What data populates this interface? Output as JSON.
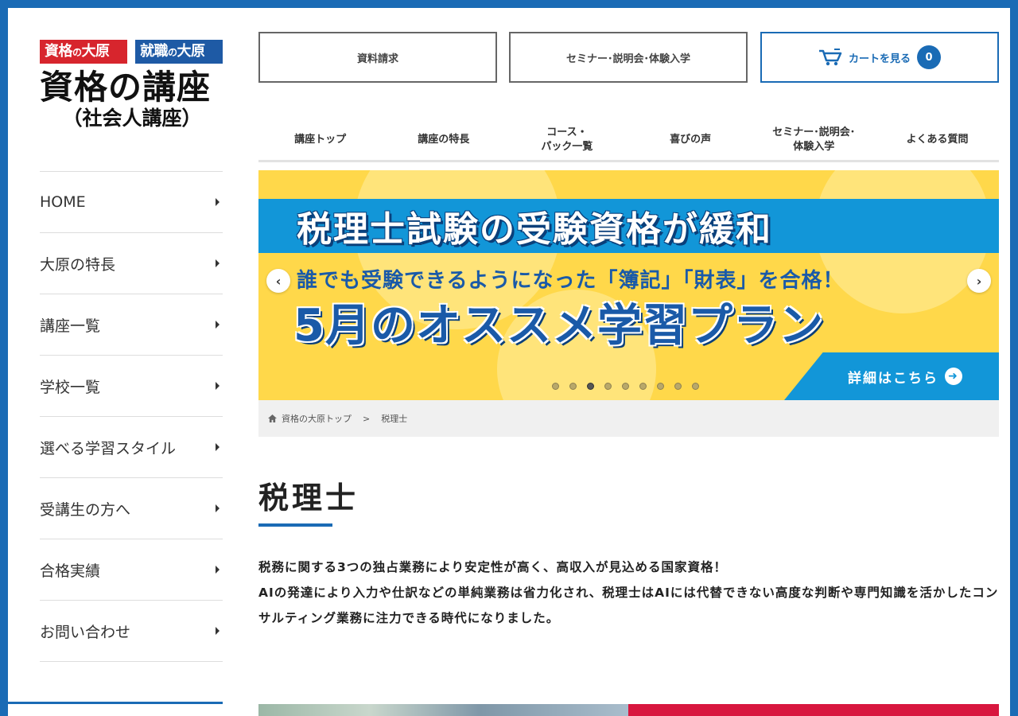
{
  "logo": {
    "tag1_a": "資格",
    "tag1_b": "の",
    "tag1_c": "大原",
    "tag2_a": "就職",
    "tag2_b": "の",
    "tag2_c": "大原",
    "title": "資格の講座",
    "subtitle": "（社会人講座）"
  },
  "sidebar": {
    "items": [
      {
        "label": "HOME"
      },
      {
        "label": "大原の特長"
      },
      {
        "label": "講座一覧"
      },
      {
        "label": "学校一覧"
      },
      {
        "label": "選べる学習スタイル"
      },
      {
        "label": "受講生の方へ"
      },
      {
        "label": "合格実績"
      },
      {
        "label": "お問い合わせ"
      }
    ]
  },
  "top_buttons": {
    "request": "資料請求",
    "seminar": "セミナー･説明会･体験入学",
    "cart": "カートを見る",
    "cart_count": "0"
  },
  "main_nav": {
    "items": [
      {
        "label": "講座トップ"
      },
      {
        "label": "講座の特長"
      },
      {
        "label": "コース・\nパック一覧"
      },
      {
        "label": "喜びの声"
      },
      {
        "label": "セミナー･説明会･\n体験入学"
      },
      {
        "label": "よくある質問"
      }
    ]
  },
  "banner": {
    "headline": "税理士試験の受験資格が緩和",
    "line2": "誰でも受験できるようになった「簿記」「財表」を合格！",
    "line3": "5月のオススメ学習プラン",
    "cta": "詳細はこちら",
    "slide_count": 9,
    "active_slide": 3,
    "colors": {
      "background": "#ffd84a",
      "strip": "#1296d8",
      "text": "#1a5aa8"
    }
  },
  "breadcrumb": {
    "home": "資格の大原トップ",
    "separator": ">",
    "current": "税理士"
  },
  "content": {
    "title": "税理士",
    "paragraph1": "税務に関する3つの独占業務により安定性が高く、高収入が見込める国家資格！",
    "paragraph2": "AIの発達により入力や仕訳などの単純業務は省力化され、税理士はAIには代替できない高度な判断や専門知識を活かしたコンサルティング業務に注力できる時代になりました。"
  },
  "colors": {
    "accent": "#1a6bb5",
    "logo_red": "#d7252d",
    "logo_blue": "#1e5aa5"
  }
}
